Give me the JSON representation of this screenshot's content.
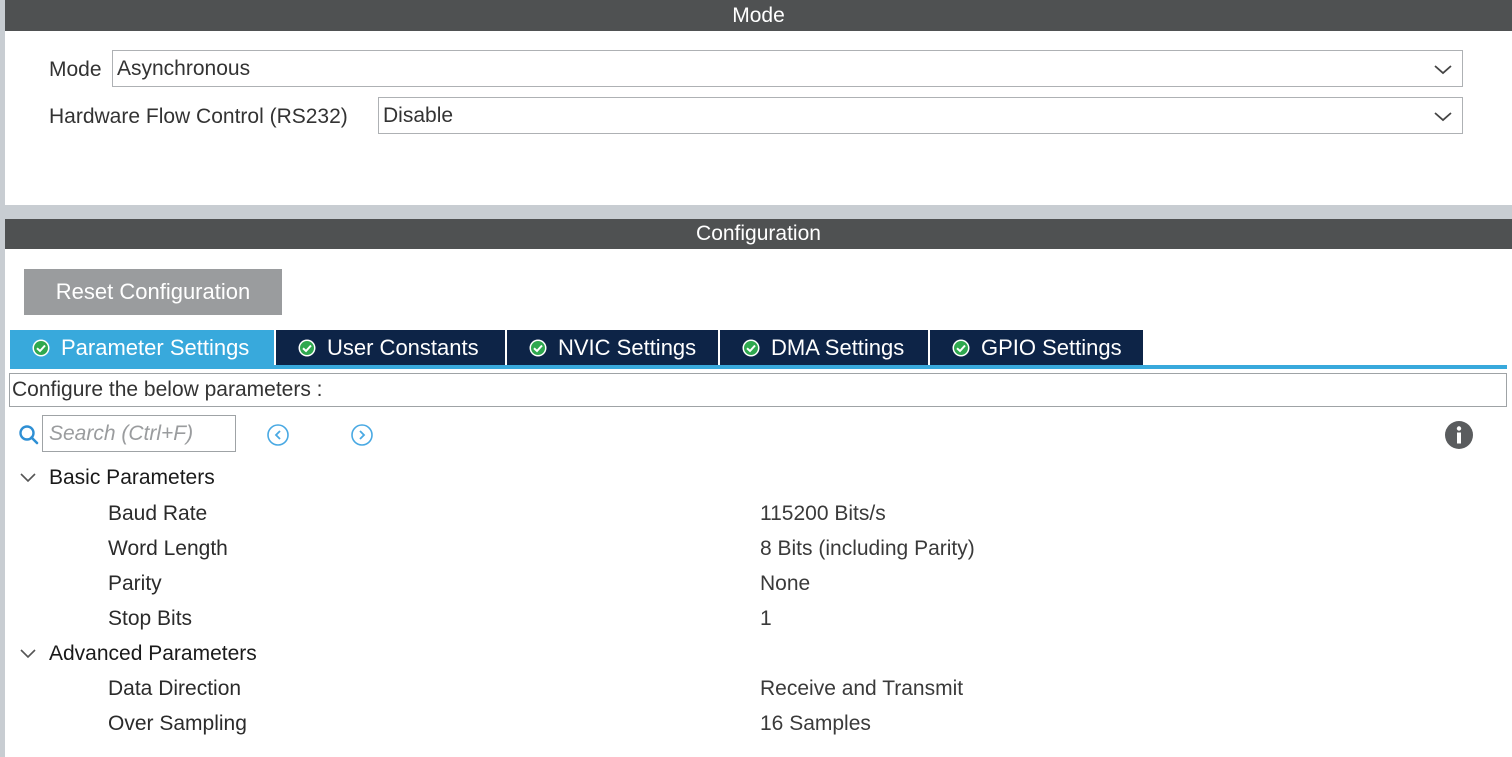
{
  "mode_section": {
    "title": "Mode",
    "mode_label": "Mode",
    "mode_value": "Asynchronous",
    "flow_label": "Hardware Flow Control (RS232)",
    "flow_value": "Disable"
  },
  "config_section": {
    "title": "Configuration",
    "reset_label": "Reset Configuration",
    "tabs": [
      {
        "label": "Parameter Settings"
      },
      {
        "label": "User Constants"
      },
      {
        "label": "NVIC Settings"
      },
      {
        "label": "DMA Settings"
      },
      {
        "label": "GPIO Settings"
      }
    ],
    "description": "Configure the below parameters :",
    "search_placeholder": "Search (Ctrl+F)",
    "groups": [
      {
        "label": "Basic Parameters",
        "params": [
          {
            "name": "Baud Rate",
            "value": "115200 Bits/s"
          },
          {
            "name": "Word Length",
            "value": "8 Bits (including Parity)"
          },
          {
            "name": "Parity",
            "value": "None"
          },
          {
            "name": "Stop Bits",
            "value": "1"
          }
        ]
      },
      {
        "label": "Advanced Parameters",
        "params": [
          {
            "name": "Data Direction",
            "value": "Receive and Transmit"
          },
          {
            "name": "Over Sampling",
            "value": "16 Samples"
          }
        ]
      }
    ]
  },
  "colors": {
    "header_bg": "#4f5152",
    "tab_active": "#38a9dc",
    "tab_inactive": "#0d2447",
    "reset_button": "#9a9c9e",
    "check_icon": "#2fa84f"
  },
  "icons": {
    "search": "search-icon",
    "prev": "chevron-left-circle-icon",
    "next": "chevron-right-circle-icon",
    "info": "info-icon",
    "tab_status": "check-circle-icon",
    "dropdown": "chevron-down-icon",
    "group_toggle": "chevron-down-icon"
  }
}
